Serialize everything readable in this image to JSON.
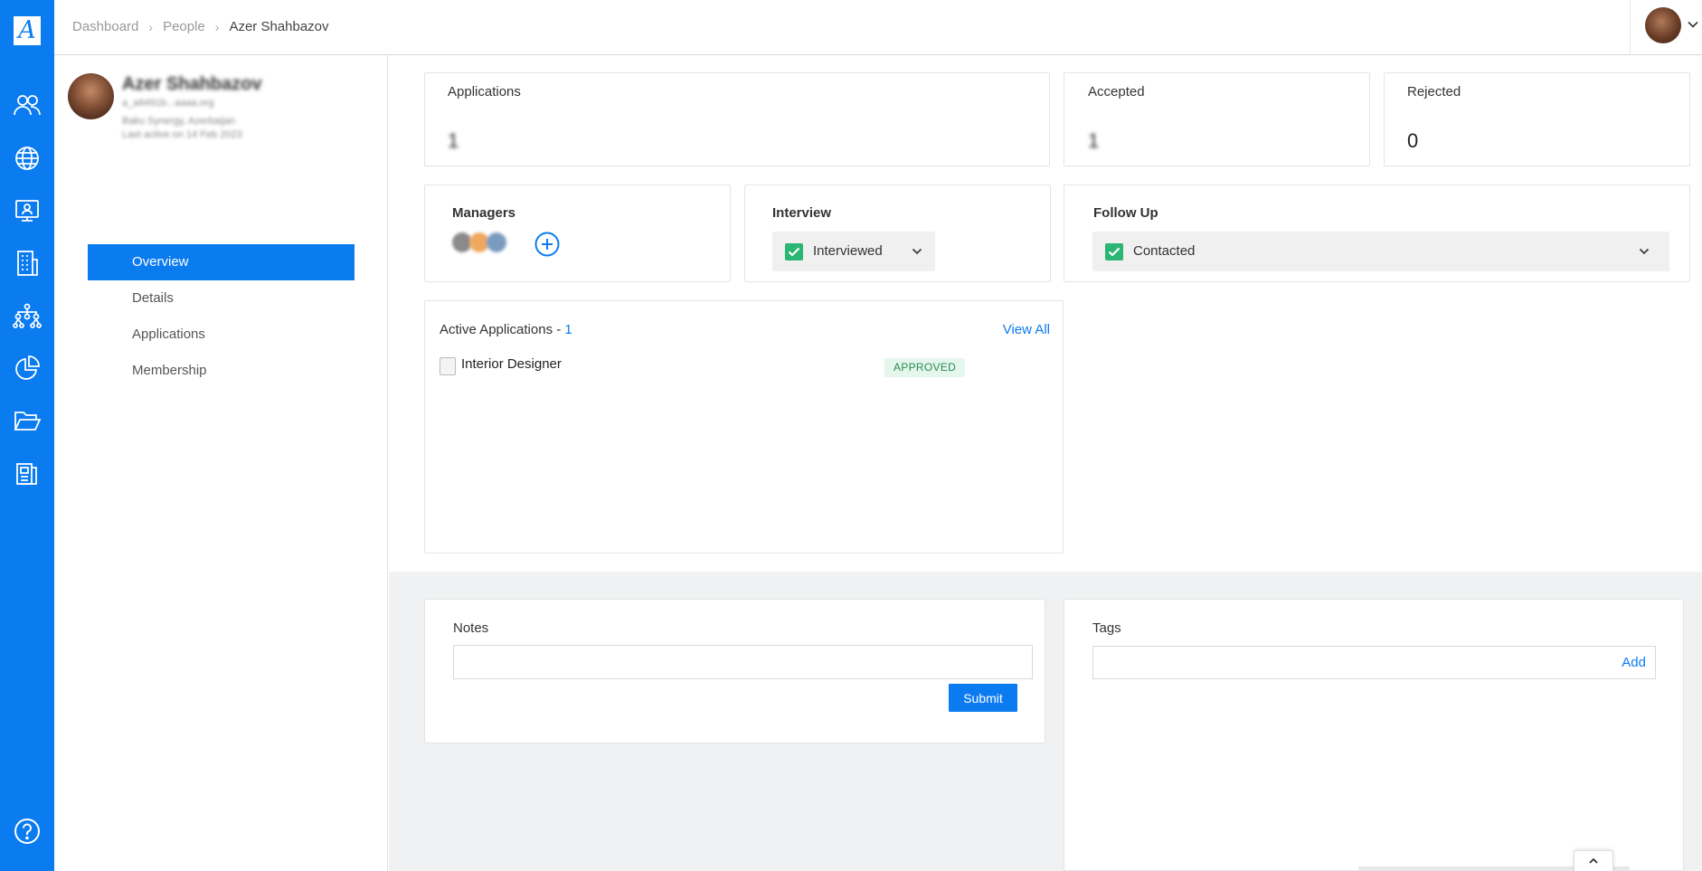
{
  "app": {
    "logo_letter": "A",
    "accent_color": "#0b7bf0",
    "rail_icons": [
      "people-icon",
      "globe-icon",
      "monitor-user-icon",
      "building-icon",
      "org-chart-icon",
      "pie-chart-icon",
      "folder-open-icon",
      "document-icon",
      "help-icon"
    ]
  },
  "breadcrumb": {
    "items": [
      "Dashboard",
      "People"
    ],
    "current": "Azer Shahbazov"
  },
  "profile": {
    "name": "Azer Shahbazov",
    "email": "a_a8491b...aaaa.org",
    "location": "Baku Synergy, Azerbaijan",
    "last_active": "Last active on 14 Feb 2023"
  },
  "menu": {
    "items": [
      "Overview",
      "Details",
      "Applications",
      "Membership"
    ],
    "active": "Overview"
  },
  "stats": {
    "applications": {
      "label": "Applications",
      "value": "1"
    },
    "accepted": {
      "label": "Accepted",
      "value": "1"
    },
    "rejected": {
      "label": "Rejected",
      "value": "0"
    }
  },
  "managers": {
    "label": "Managers",
    "avatar_colors": [
      "#8a8a8a",
      "#f0a860",
      "#7a9bbf"
    ]
  },
  "interview": {
    "label": "Interview",
    "status": "Interviewed"
  },
  "follow_up": {
    "label": "Follow Up",
    "status": "Contacted"
  },
  "active_applications": {
    "label": "Active Applications - ",
    "count": "1",
    "view_all": "View All",
    "items": [
      {
        "title": "Interior Designer",
        "status": "APPROVED"
      }
    ]
  },
  "notes": {
    "label": "Notes",
    "value": "",
    "submit_label": "Submit"
  },
  "tags": {
    "label": "Tags",
    "value": "",
    "add_label": "Add"
  },
  "colors": {
    "success": "#2bb673",
    "badge_bg": "#e5f7ec",
    "badge_text": "#2a8a55"
  }
}
